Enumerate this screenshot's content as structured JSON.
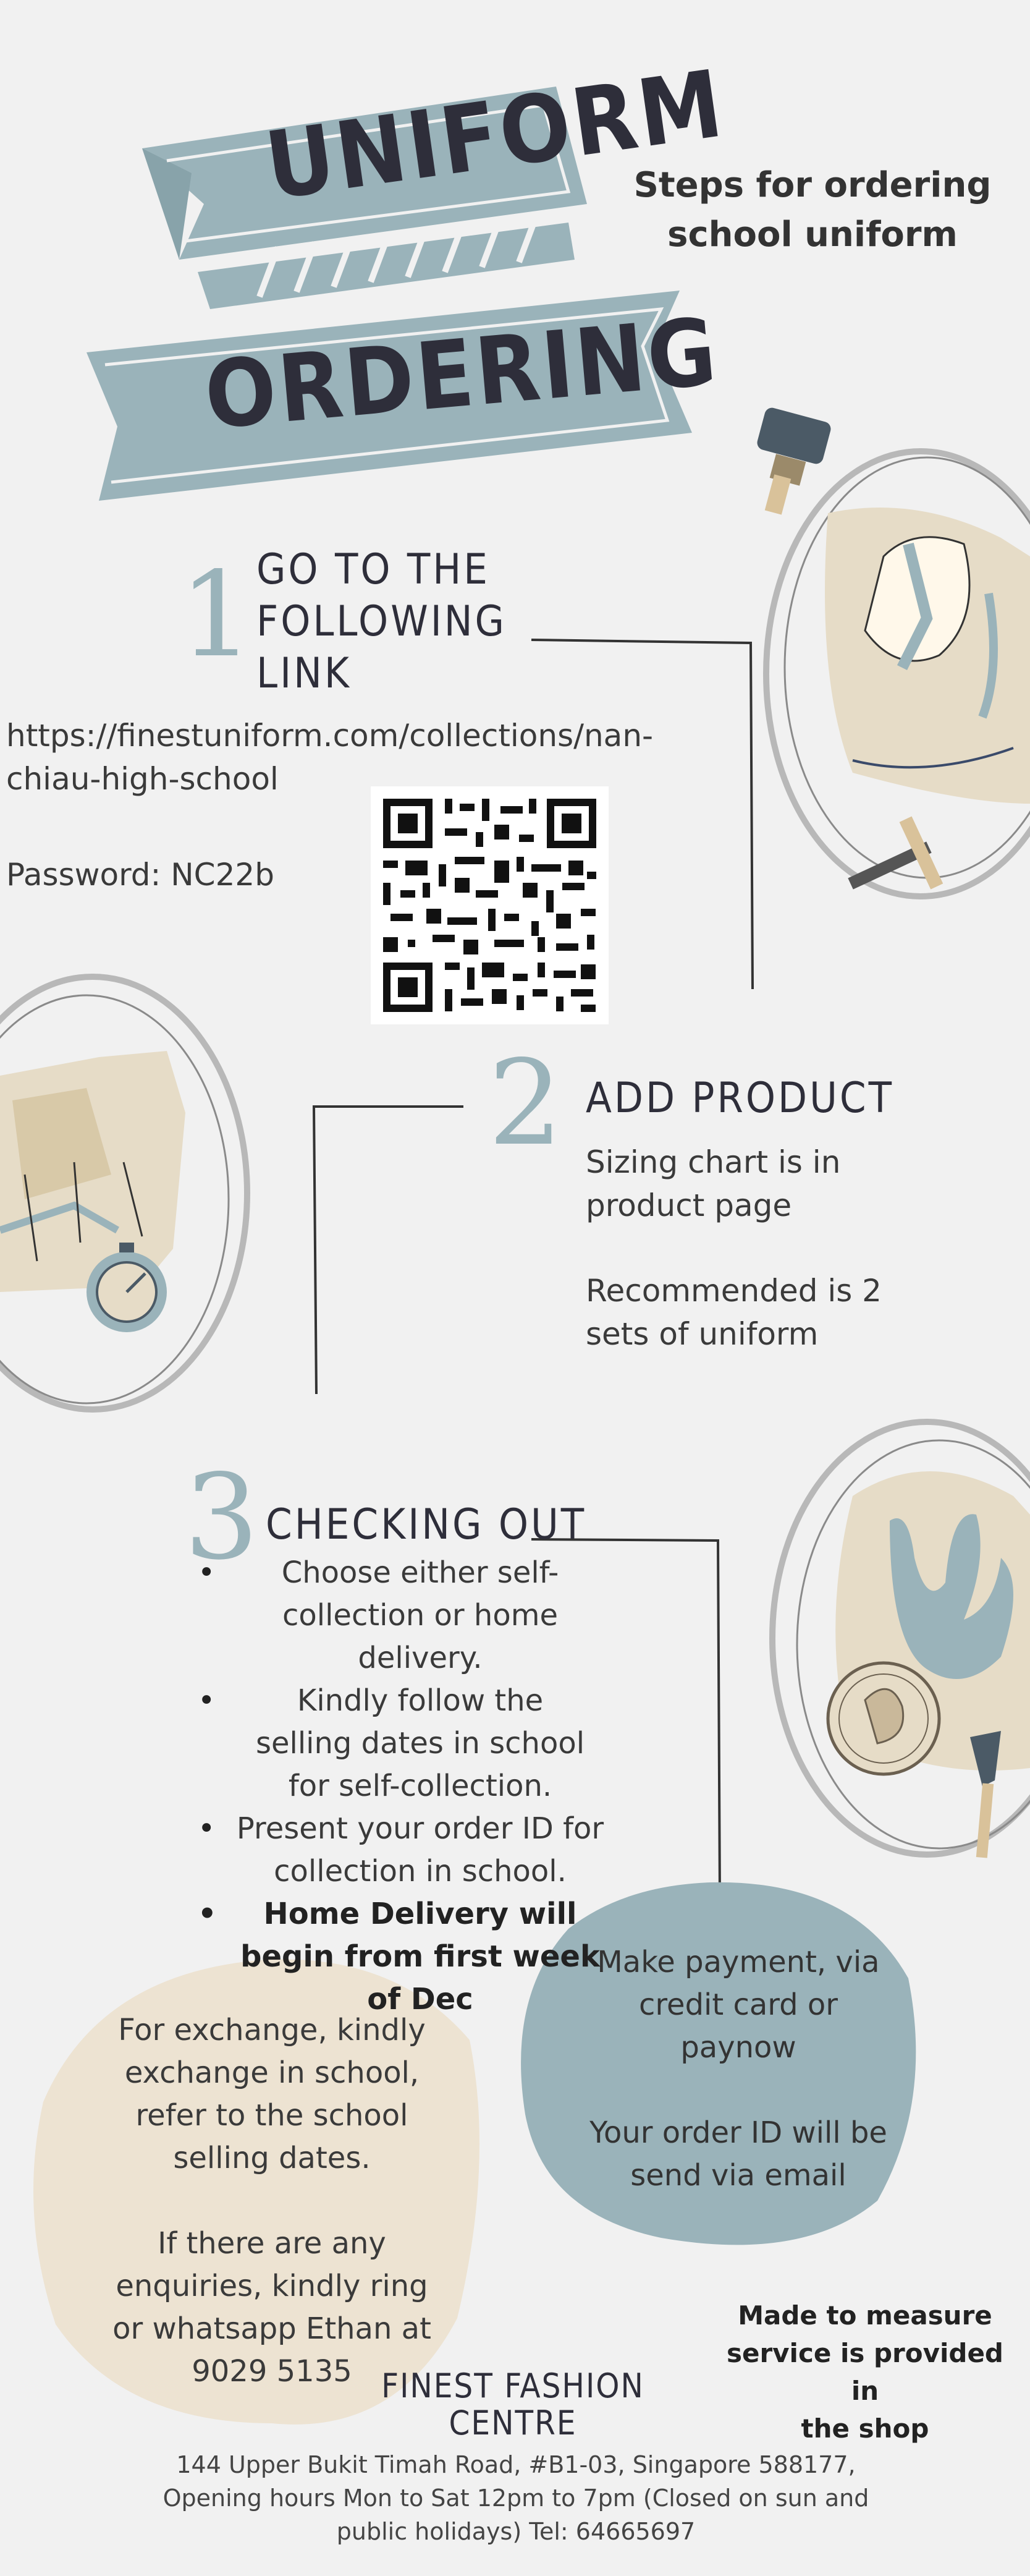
{
  "banner": {
    "line1": "UNIFORM",
    "line2": "ORDERING"
  },
  "subtitle": {
    "line1": "Steps for ordering",
    "line2": "school uniform"
  },
  "step1": {
    "number": "1",
    "heading": [
      "GO TO THE",
      "FOLLOWING",
      "LINK"
    ],
    "link_line1": "https://finestuniform.com/collections/nan-",
    "link_line2": "chiau-high-school",
    "password": "Password: NC22b"
  },
  "step2": {
    "number": "2",
    "heading": "ADD PRODUCT",
    "text1_line1": "Sizing chart is in",
    "text1_line2": "product page",
    "text2_line1": "Recommended is 2",
    "text2_line2": "sets of uniform"
  },
  "step3": {
    "number": "3",
    "heading": "CHECKING OUT",
    "bullets": [
      "Choose either self-collection or home delivery.",
      "Kindly follow the selling dates in school for self-collection.",
      "Present your order ID for collection in school.",
      "Home Delivery will begin from first week of Dec"
    ]
  },
  "payment_blob": {
    "line1": "Make payment, via",
    "line2": "credit card or",
    "line3": "paynow",
    "line4": "Your order ID will be",
    "line5": "send via email"
  },
  "exchange_blob": {
    "line1": "For exchange, kindly",
    "line2": "exchange in school,",
    "line3": "refer to the school",
    "line4": "selling dates.",
    "line5": "If there are any",
    "line6": "enquiries, kindly ring",
    "line7": "or whatsapp Ethan at",
    "line8": "9029 5135"
  },
  "measure_note": {
    "line1": "Made to measure",
    "line2": "service is provided in",
    "line3": "the shop"
  },
  "footer": {
    "name_line1": "FINEST FASHION",
    "name_line2": "CENTRE",
    "addr_line1": "144 Upper Bukit Timah Road, #B1-03, Singapore 588177,",
    "addr_line2": "Opening hours Mon to Sat 12pm to 7pm (Closed on sun and",
    "addr_line3": "public holidays) Tel: 64665697"
  },
  "colors": {
    "accent": "#9ab3ba",
    "beige": "#ede3d2",
    "ink": "#2e2e3a",
    "background": "#f1f1f1"
  },
  "icons": [
    "qr-code-icon",
    "paintbrush-icon",
    "pickaxe-icon",
    "compass-icon",
    "coin-icon",
    "trowel-icon",
    "fossil-illustration",
    "map-illustration",
    "footprint-illustration"
  ]
}
